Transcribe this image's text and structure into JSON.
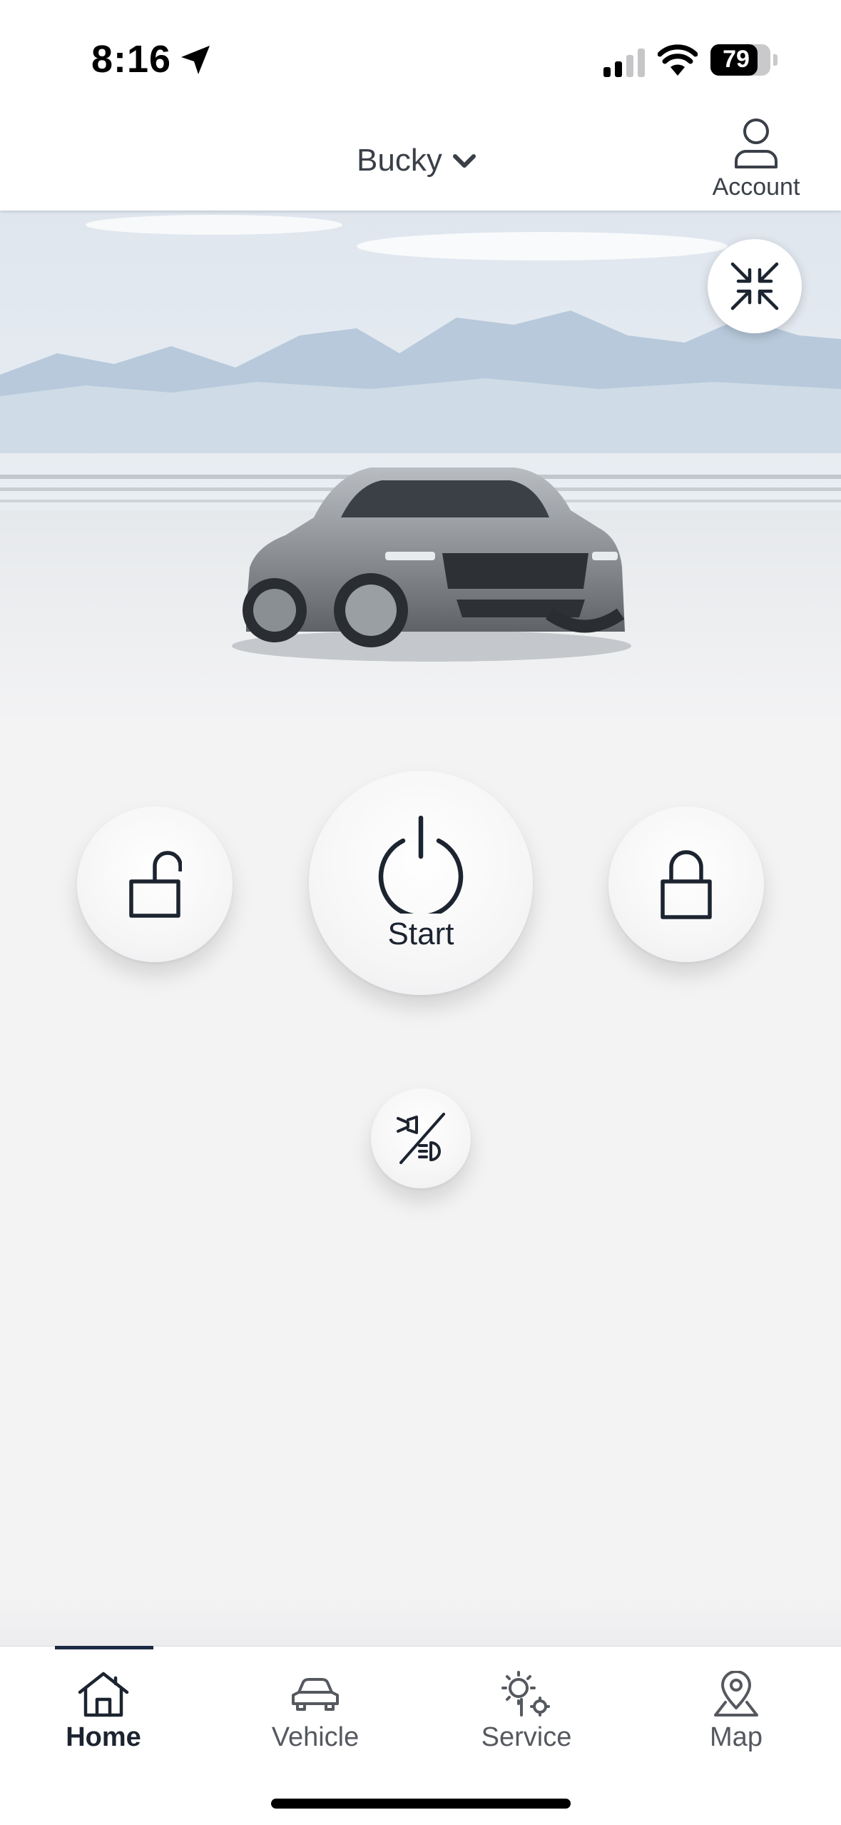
{
  "status_bar": {
    "time": "8:16",
    "battery_percent": "79",
    "battery_level": 0.79
  },
  "header": {
    "vehicle_name": "Bucky",
    "account_label": "Account"
  },
  "controls": {
    "start_label": "Start"
  },
  "tabs": [
    {
      "label": "Home",
      "icon": "home-icon",
      "active": true
    },
    {
      "label": "Vehicle",
      "icon": "car-icon",
      "active": false
    },
    {
      "label": "Service",
      "icon": "service-gear-icon",
      "active": false
    },
    {
      "label": "Map",
      "icon": "map-pin-icon",
      "active": false
    }
  ],
  "colors": {
    "accent": "#1c2a44",
    "background": "#f3f3f4",
    "icon": "#1c2430"
  }
}
